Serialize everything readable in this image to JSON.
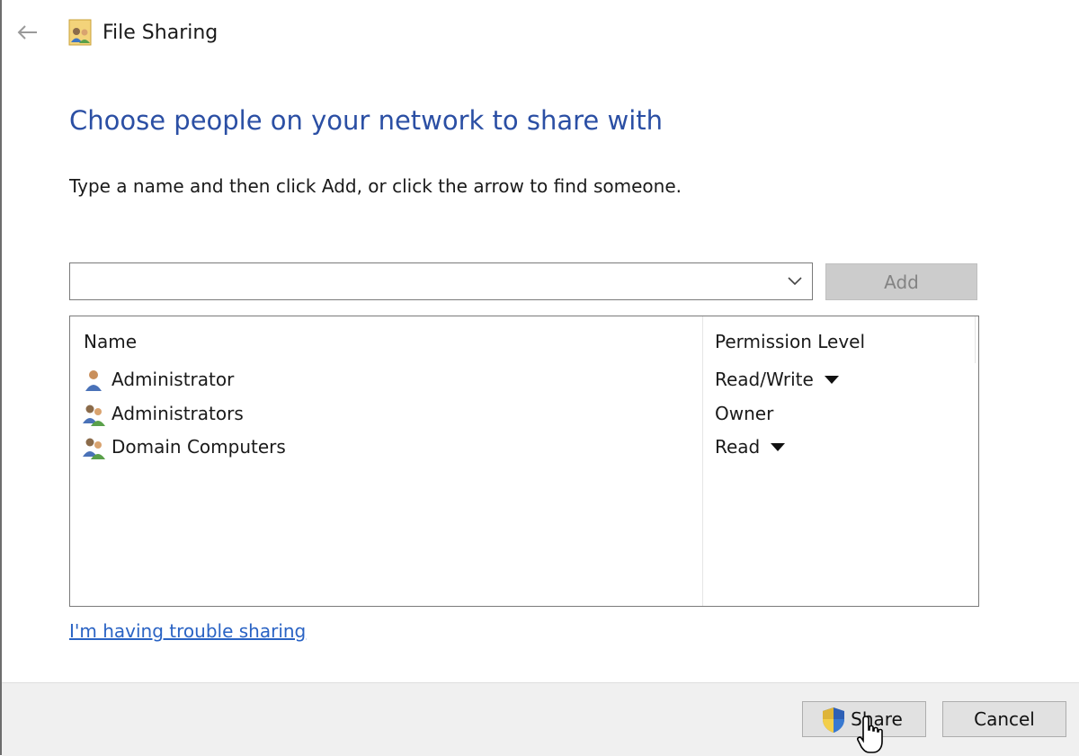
{
  "window": {
    "title": "File Sharing"
  },
  "page": {
    "heading": "Choose people on your network to share with",
    "instruction": "Type a name and then click Add, or click the arrow to find someone."
  },
  "name_input": {
    "value": "",
    "placeholder": ""
  },
  "add_button": {
    "label": "Add",
    "enabled": false
  },
  "list": {
    "columns": [
      "Name",
      "Permission Level"
    ],
    "rows": [
      {
        "name": "Administrator",
        "icon": "user-icon",
        "permission": "Read/Write",
        "has_dropdown": true
      },
      {
        "name": "Administrators",
        "icon": "group-icon",
        "permission": "Owner",
        "has_dropdown": false
      },
      {
        "name": "Domain Computers",
        "icon": "group-icon",
        "permission": "Read",
        "has_dropdown": true
      }
    ]
  },
  "help_link": "I'm having trouble sharing",
  "footer": {
    "share_label": "Share",
    "cancel_label": "Cancel"
  },
  "colors": {
    "heading": "#2b4fa4",
    "link": "#2a63c4",
    "footer_bg": "#f0f0f0",
    "button_bg": "#e1e1e1"
  }
}
